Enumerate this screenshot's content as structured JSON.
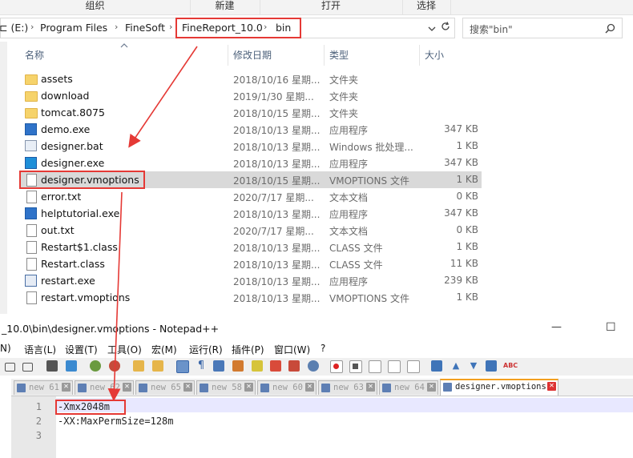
{
  "ribbon": {
    "groups": [
      "组织",
      "新建",
      "打开",
      "选择"
    ]
  },
  "address": {
    "drive_prefix": "⊏ (E:)",
    "crumbs": [
      "Program Files",
      "FineSoft",
      "FineReport_10.0",
      "bin"
    ],
    "separator": "›",
    "dropdown_icon": "chevron-down-icon",
    "refresh_icon": "refresh-icon"
  },
  "search": {
    "placeholder": "搜索\"bin\""
  },
  "columns": {
    "name": "名称",
    "modified": "修改日期",
    "type": "类型",
    "size": "大小"
  },
  "files": [
    {
      "name": "assets",
      "date": "2018/10/16 星期...",
      "type": "文件夹",
      "size": "",
      "icon": "folder"
    },
    {
      "name": "download",
      "date": "2019/1/30 星期...",
      "type": "文件夹",
      "size": "",
      "icon": "folder"
    },
    {
      "name": "tomcat.8075",
      "date": "2018/10/15 星期...",
      "type": "文件夹",
      "size": "",
      "icon": "folder"
    },
    {
      "name": "demo.exe",
      "date": "2018/10/13 星期...",
      "type": "应用程序",
      "size": "347 KB",
      "icon": "app"
    },
    {
      "name": "designer.bat",
      "date": "2018/10/13 星期...",
      "type": "Windows 批处理...",
      "size": "1 KB",
      "icon": "bat"
    },
    {
      "name": "designer.exe",
      "date": "2018/10/13 星期...",
      "type": "应用程序",
      "size": "347 KB",
      "icon": "app"
    },
    {
      "name": "designer.vmoptions",
      "date": "2018/10/15 星期...",
      "type": "VMOPTIONS 文件",
      "size": "1 KB",
      "icon": "doc"
    },
    {
      "name": "error.txt",
      "date": "2020/7/17 星期...",
      "type": "文本文档",
      "size": "0 KB",
      "icon": "doc"
    },
    {
      "name": "helptutorial.exe",
      "date": "2018/10/13 星期...",
      "type": "应用程序",
      "size": "347 KB",
      "icon": "app"
    },
    {
      "name": "out.txt",
      "date": "2020/7/17 星期...",
      "type": "文本文档",
      "size": "0 KB",
      "icon": "doc"
    },
    {
      "name": "Restart$1.class",
      "date": "2018/10/13 星期...",
      "type": "CLASS 文件",
      "size": "1 KB",
      "icon": "doc"
    },
    {
      "name": "Restart.class",
      "date": "2018/10/13 星期...",
      "type": "CLASS 文件",
      "size": "11 KB",
      "icon": "doc"
    },
    {
      "name": "restart.exe",
      "date": "2018/10/13 星期...",
      "type": "应用程序",
      "size": "239 KB",
      "icon": "app"
    },
    {
      "name": "restart.vmoptions",
      "date": "2018/10/13 星期...",
      "type": "VMOPTIONS 文件",
      "size": "1 KB",
      "icon": "doc"
    }
  ],
  "notepad": {
    "title": "_10.0\\bin\\designer.vmoptions - Notepad++",
    "window_controls": {
      "minimize": "—",
      "maximize": "☐"
    },
    "menu": [
      "N)",
      "语言(L)",
      "设置(T)",
      "工具(O)",
      "宏(M)",
      "运行(R)",
      "插件(P)",
      "窗口(W)",
      "?"
    ],
    "tabs": [
      {
        "label": "new 61",
        "active": false
      },
      {
        "label": "new 62",
        "active": false
      },
      {
        "label": "new 65",
        "active": false
      },
      {
        "label": "new 58",
        "active": false
      },
      {
        "label": "new 60",
        "active": false
      },
      {
        "label": "new 63",
        "active": false
      },
      {
        "label": "new 64",
        "active": false
      },
      {
        "label": "designer.vmoptions",
        "active": true
      }
    ],
    "tab_close": "✕",
    "lines": [
      {
        "num": "1",
        "text": "-Xmx2048m"
      },
      {
        "num": "2",
        "text": "-XX:MaxPermSize=128m"
      },
      {
        "num": "3",
        "text": ""
      }
    ]
  },
  "colors": {
    "annotation_red": "#e53935",
    "selected_row": "#d9d9d9",
    "active_tab_accent": "#f2a020"
  }
}
